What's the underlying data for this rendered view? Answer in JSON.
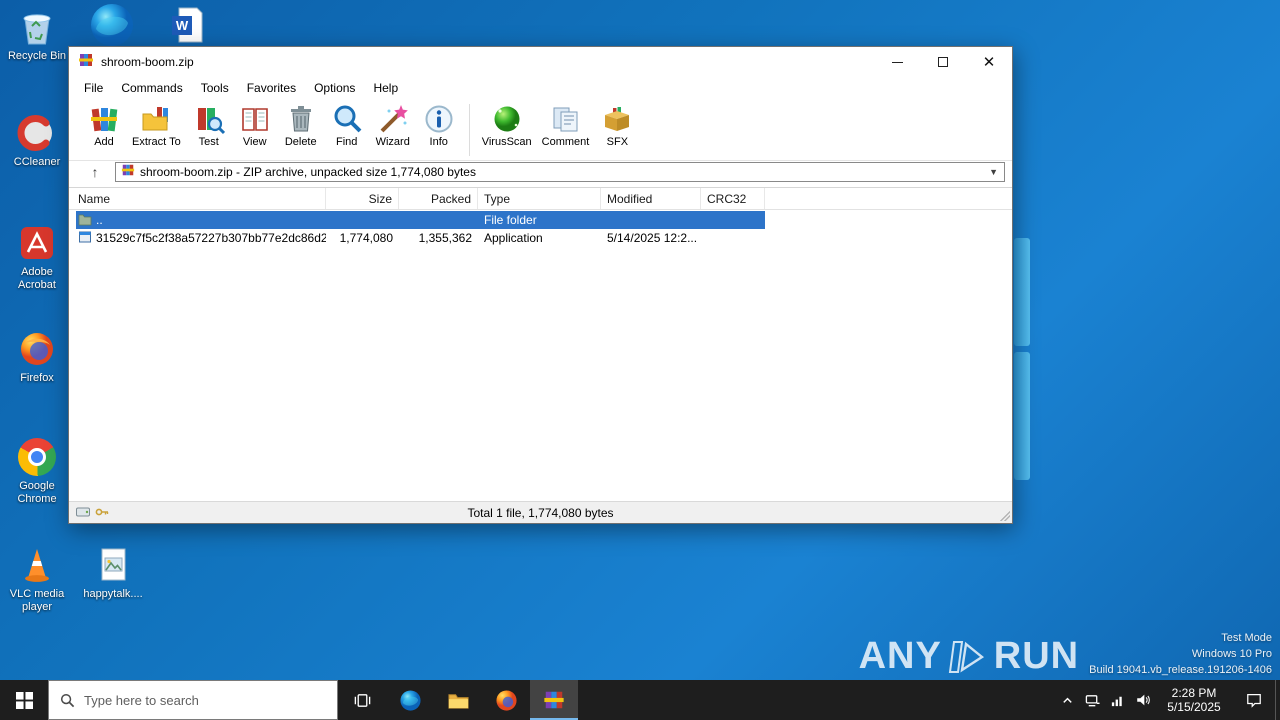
{
  "colors": {
    "accent": "#0078d7",
    "selection": "#2d74c9",
    "taskbar": "#1e1e1e",
    "desktop_blue": "#1173bd"
  },
  "desktop": {
    "icons": [
      {
        "id": "recycle-bin",
        "label": "Recycle Bin"
      },
      {
        "id": "edge",
        "label": ""
      },
      {
        "id": "word-document",
        "label": ""
      },
      {
        "id": "ccleaner",
        "label": "CCleaner"
      },
      {
        "id": "adobe-acrobat",
        "label": "Adobe Acrobat"
      },
      {
        "id": "firefox",
        "label": "Firefox"
      },
      {
        "id": "google-chrome",
        "label": "Google Chrome"
      },
      {
        "id": "vlc",
        "label": "VLC media player"
      },
      {
        "id": "happytalk",
        "label": "happytalk...."
      }
    ]
  },
  "window": {
    "title": "shroom-boom.zip",
    "menu": [
      "File",
      "Commands",
      "Tools",
      "Favorites",
      "Options",
      "Help"
    ],
    "toolbar": [
      "Add",
      "Extract To",
      "Test",
      "View",
      "Delete",
      "Find",
      "Wizard",
      "Info",
      "VirusScan",
      "Comment",
      "SFX"
    ],
    "address": "shroom-boom.zip - ZIP archive, unpacked size 1,774,080 bytes",
    "columns": [
      "Name",
      "Size",
      "Packed",
      "Type",
      "Modified",
      "CRC32"
    ],
    "rows": [
      {
        "name": "..",
        "size": "",
        "packed": "",
        "type": "File folder",
        "modified": "",
        "crc32": ""
      },
      {
        "name": "31529c7f5c2f38a57227b307bb77e2dc86d28...",
        "size": "1,774,080",
        "packed": "1,355,362",
        "type": "Application",
        "modified": "5/14/2025 12:2...",
        "crc32": ""
      }
    ],
    "status": "Total 1 file, 1,774,080 bytes"
  },
  "taskbar": {
    "search_placeholder": "Type here to search",
    "clock": {
      "time": "2:28 PM",
      "date": "5/15/2025"
    }
  },
  "watermark": {
    "brand_left": "ANY",
    "brand_right": "RUN",
    "mode": "Test Mode",
    "os": "Windows 10 Pro",
    "build": "Build 19041.vb_release.191206-1406"
  }
}
